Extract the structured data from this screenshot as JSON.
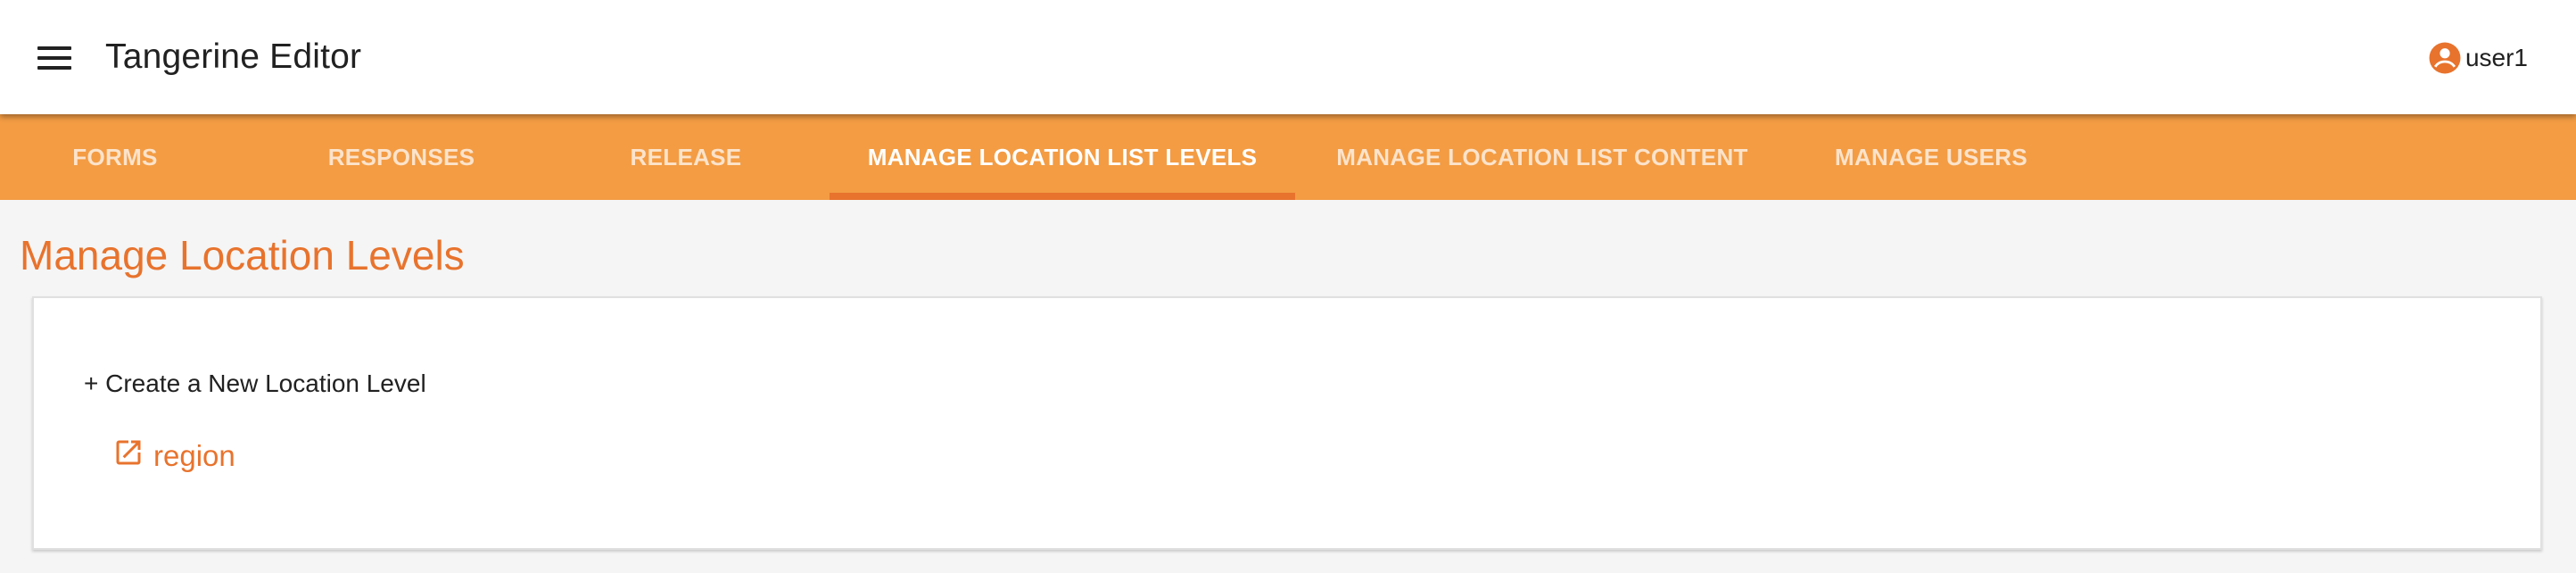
{
  "app": {
    "title": "Tangerine Editor"
  },
  "header": {
    "menu_icon": "hamburger-menu-icon",
    "user_icon": "account-circle-icon",
    "user_name": "user1"
  },
  "tabs": [
    {
      "label": "FORMS",
      "active": false
    },
    {
      "label": "RESPONSES",
      "active": false
    },
    {
      "label": "RELEASE",
      "active": false
    },
    {
      "label": "MANAGE LOCATION LIST LEVELS",
      "active": true
    },
    {
      "label": "MANAGE LOCATION LIST CONTENT",
      "active": false
    },
    {
      "label": "MANAGE USERS",
      "active": false
    }
  ],
  "page": {
    "title": "Manage Location Levels",
    "create_label": "+ Create a New Location Level",
    "levels": [
      {
        "label": "region",
        "icon": "open-in-new-icon"
      }
    ]
  },
  "colors": {
    "tab_bar": "#f39c44",
    "accent": "#e8732d",
    "page_background": "#f5f5f5"
  }
}
